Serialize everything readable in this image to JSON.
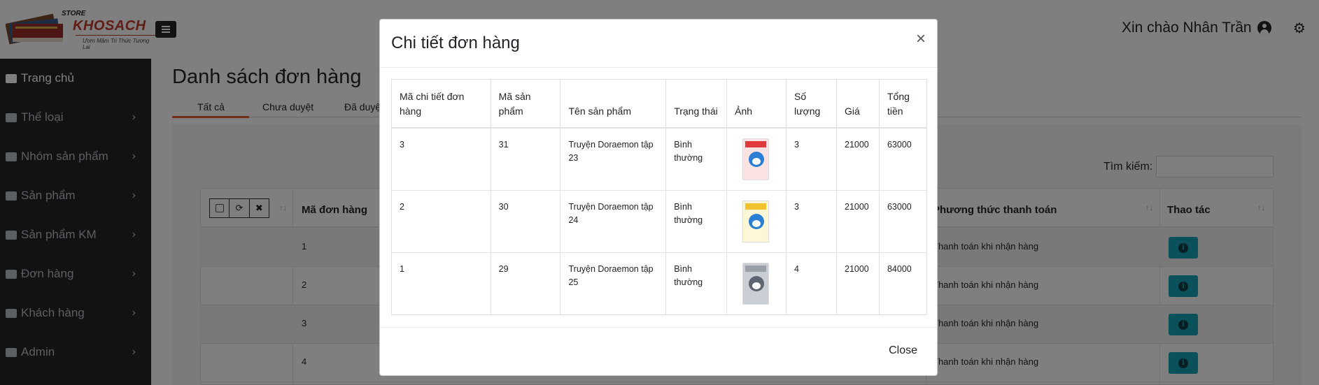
{
  "header": {
    "logo_store": "STORE",
    "logo_name": "KHOSACH",
    "logo_tagline": "Ươm Mầm Tri Thức Tương Lai",
    "greeting": "Xin chào Nhân Trần"
  },
  "sidebar": {
    "items": [
      {
        "label": "Trang chủ",
        "icon": "home-icon"
      },
      {
        "label": "Thể loại",
        "icon": "folder-icon"
      },
      {
        "label": "Nhóm sản phẩm",
        "icon": "folder-icon"
      },
      {
        "label": "Sản phẩm",
        "icon": "book-icon"
      },
      {
        "label": "Sản phẩm KM",
        "icon": "book-icon"
      },
      {
        "label": "Đơn hàng",
        "icon": "file-icon"
      },
      {
        "label": "Khách hàng",
        "icon": "users-icon"
      },
      {
        "label": "Admin",
        "icon": "user-icon"
      }
    ]
  },
  "main": {
    "title": "Danh sách đơn hàng",
    "tabs": [
      {
        "label": "Tất cả"
      },
      {
        "label": "Chưa duyệt"
      },
      {
        "label": "Đã duyệt"
      }
    ],
    "search_label": "Tìm kiếm:",
    "orders_table": {
      "headers": {
        "order_id": "Mã đơn hàng",
        "payment": "Phương thức thanh toán",
        "actions": "Thao tác"
      },
      "rows": [
        {
          "id": "1",
          "payment": "Thanh toán khi nhận hàng"
        },
        {
          "id": "2",
          "payment": "Thanh toán khi nhận hàng"
        },
        {
          "id": "3",
          "payment": "Thanh toán khi nhận hàng"
        },
        {
          "id": "4",
          "payment": "Thanh toán khi nhận hàng"
        }
      ]
    }
  },
  "modal": {
    "title": "Chi tiết đơn hàng",
    "close_x": "×",
    "close_label": "Close",
    "headers": [
      "Mã chi tiết đơn hàng",
      "Mã sản phẩm",
      "Tên sản phẩm",
      "Trạng thái",
      "Ảnh",
      "Số lượng",
      "Giá",
      "Tổng tiền"
    ],
    "rows": [
      {
        "detail_id": "3",
        "product_id": "31",
        "name": "Truyện Doraemon tập 23",
        "status": "Bình thường",
        "qty": "3",
        "price": "21000",
        "total": "63000",
        "cover_color": "#e03a3a"
      },
      {
        "detail_id": "2",
        "product_id": "30",
        "name": "Truyện Doraemon tập 24",
        "status": "Bình thường",
        "qty": "3",
        "price": "21000",
        "total": "63000",
        "cover_color": "#f2c12e"
      },
      {
        "detail_id": "1",
        "product_id": "29",
        "name": "Truyện Doraemon tập 25",
        "status": "Bình thường",
        "qty": "4",
        "price": "21000",
        "total": "84000",
        "cover_color": "#9aa0a8"
      }
    ]
  },
  "colors": {
    "sidebar_bg": "#212529",
    "accent_tab": "#e55b2e",
    "info_button": "#17a2b8",
    "brand_red": "#c0392b"
  }
}
